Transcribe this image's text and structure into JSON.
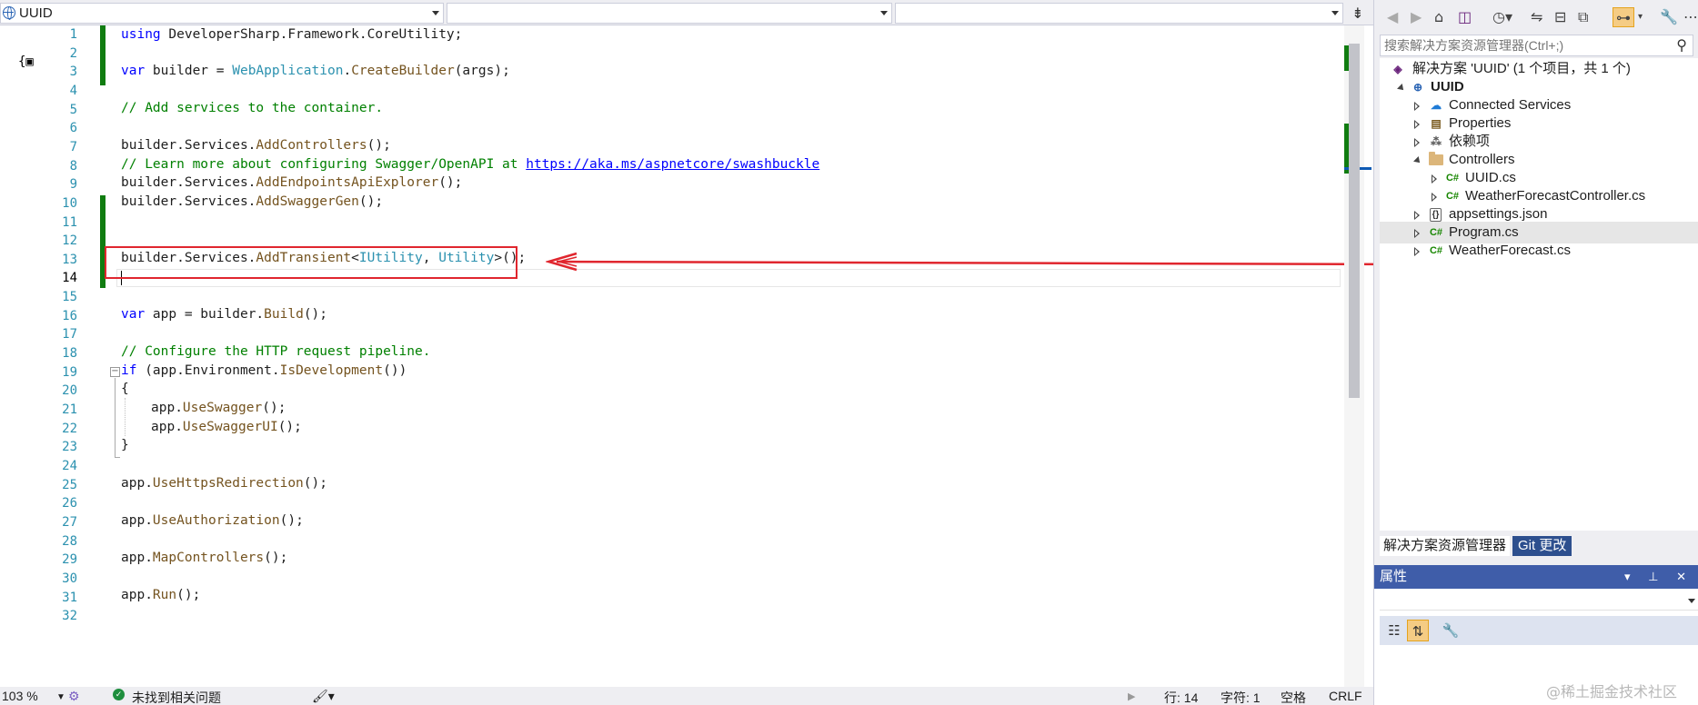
{
  "nav": {
    "project": "UUID",
    "member": "",
    "scope": ""
  },
  "line_numbers": [
    "1",
    "2",
    "3",
    "4",
    "5",
    "6",
    "7",
    "8",
    "9",
    "10",
    "11",
    "12",
    "13",
    "14",
    "15",
    "16",
    "17",
    "18",
    "19",
    "20",
    "21",
    "22",
    "23",
    "24",
    "25",
    "26",
    "27",
    "28",
    "29",
    "30",
    "31",
    "32"
  ],
  "code": {
    "l1_kw": "using",
    "l1_rest": " DeveloperSharp.Framework.CoreUtility;",
    "l3_kw": "var",
    "l3_a": " builder = ",
    "l3_ty": "WebApplication",
    "l3_dot": ".",
    "l3_fn": "CreateBuilder",
    "l3_b": "(args);",
    "l5": "// Add services to the container.",
    "l7_a": "builder.Services.",
    "l7_fn": "AddControllers",
    "l7_b": "();",
    "l8_cm": "// Learn more about configuring Swagger/OpenAPI at ",
    "l8_link": "https://aka.ms/aspnetcore/swashbuckle",
    "l9_a": "builder.Services.",
    "l9_fn": "AddEndpointsApiExplorer",
    "l9_b": "();",
    "l10_a": "builder.Services.",
    "l10_fn": "AddSwaggerGen",
    "l10_b": "();",
    "l13_a": "builder.Services.",
    "l13_fn": "AddTransient",
    "l13_lt": "<",
    "l13_t1": "IUtility",
    "l13_c": ", ",
    "l13_t2": "Utility",
    "l13_gt": ">",
    "l13_b": "();",
    "l16_kw": "var",
    "l16_a": " app = builder.",
    "l16_fn": "Build",
    "l16_b": "();",
    "l18": "// Configure the HTTP request pipeline.",
    "l19_kw": "if",
    "l19_a": " (app.Environment.",
    "l19_fn": "IsDevelopment",
    "l19_b": "())",
    "l20": "{",
    "l21_a": "app.",
    "l21_fn": "UseSwagger",
    "l21_b": "();",
    "l22_a": "app.",
    "l22_fn": "UseSwaggerUI",
    "l22_b": "();",
    "l23": "}",
    "l25_a": "app.",
    "l25_fn": "UseHttpsRedirection",
    "l25_b": "();",
    "l27_a": "app.",
    "l27_fn": "UseAuthorization",
    "l27_b": "();",
    "l29_a": "app.",
    "l29_fn": "MapControllers",
    "l29_b": "();",
    "l31_a": "app.",
    "l31_fn": "Run",
    "l31_b": "();"
  },
  "status": {
    "zoom": "103 %",
    "issues": "未找到相关问题",
    "line": "行: 14",
    "char": "字符: 1",
    "spaces": "空格",
    "eol": "CRLF"
  },
  "solution_explorer": {
    "search_placeholder": "搜索解决方案资源管理器(Ctrl+;)",
    "solution": "解决方案 'UUID' (1 个项目，共 1 个)",
    "project": "UUID",
    "items": {
      "connected": "Connected Services",
      "properties": "Properties",
      "deps": "依赖项",
      "controllers": "Controllers",
      "uuid_cs": "UUID.cs",
      "weather_ctrl": "WeatherForecastController.cs",
      "appsettings": "appsettings.json",
      "program": "Program.cs",
      "weather": "WeatherForecast.cs"
    },
    "tabs": {
      "se": "解决方案资源管理器",
      "git": "Git 更改"
    }
  },
  "properties": {
    "title": "属性"
  },
  "icons": {
    "cs_glyph": "C#",
    "json_glyph": "{}"
  },
  "colors": {
    "accent": "#3f5da9",
    "change_bar": "#107c10",
    "highlight_box": "#e0262e"
  },
  "watermark": "@稀土掘金技术社区"
}
